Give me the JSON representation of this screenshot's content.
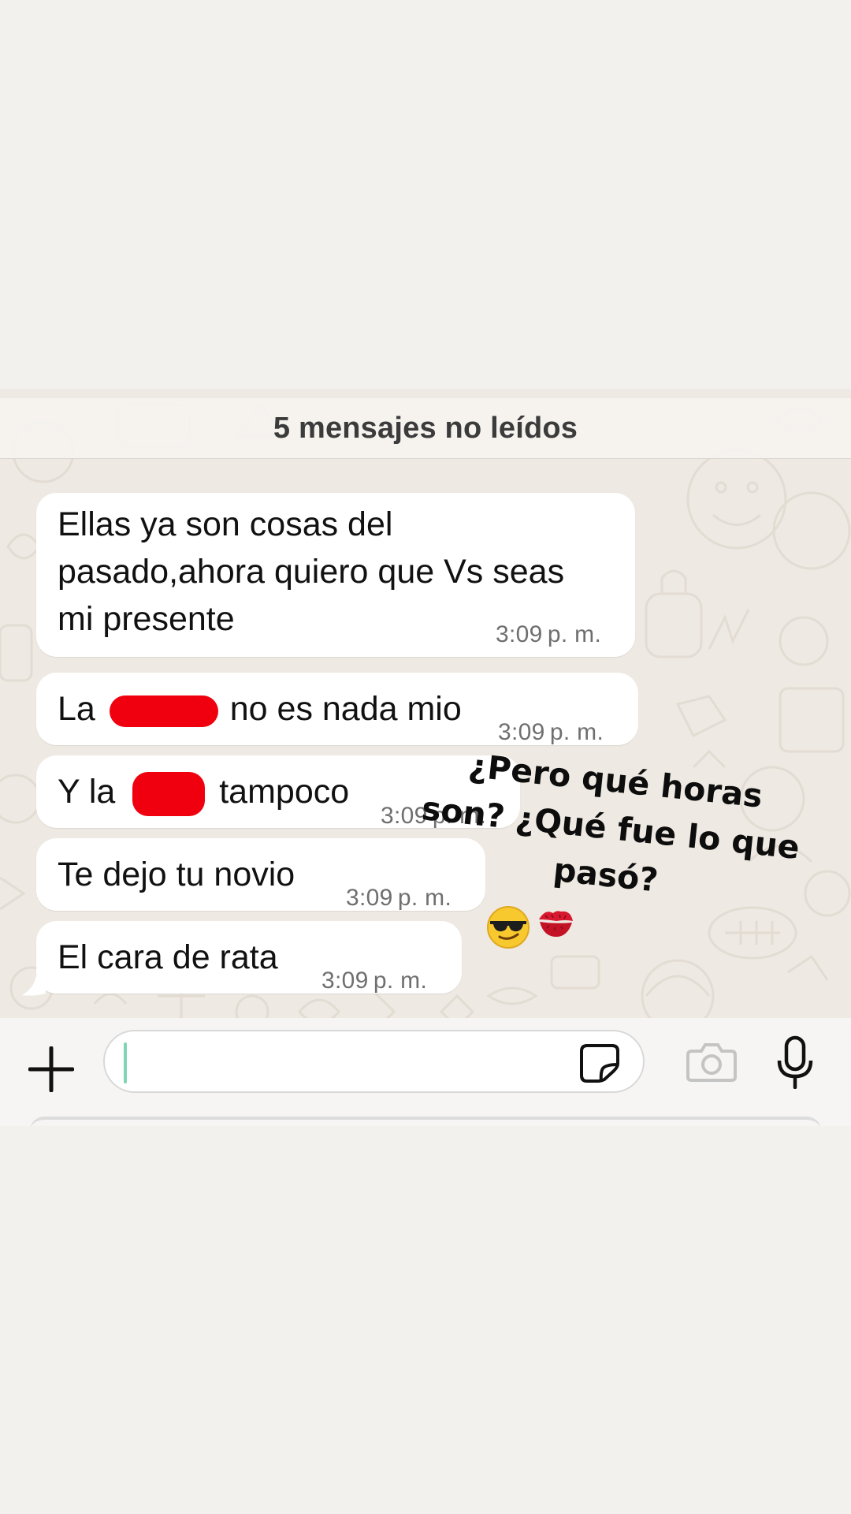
{
  "unread_banner": "5 mensajes no leídos",
  "messages": [
    {
      "lines": [
        "Ellas ya son cosas del",
        "pasado,ahora quiero que Vs seas",
        "mi presente"
      ],
      "time": "3:09 p. m."
    },
    {
      "before": "La",
      "after": "no es nada mio",
      "time": "3:09 p. m."
    },
    {
      "before": "Y la",
      "after": "tampoco",
      "time": "3:09 p. m."
    },
    {
      "text": "Te dejo tu novio",
      "time": "3:09 p. m."
    },
    {
      "text": "El cara de rata",
      "time": "3:09 p. m."
    }
  ],
  "overlay": {
    "lines": [
      "¿Pero qué horas",
      "son? ¿Qué fue lo que",
      "pasó?"
    ],
    "emojis": [
      "smiling-face-with-sunglasses",
      "kiss-mark"
    ]
  },
  "composer": {
    "icons": [
      "plus-icon",
      "sticker-icon",
      "camera-icon",
      "microphone-icon"
    ]
  },
  "colors": {
    "page_background": "#f3f1ee",
    "chat_wallpaper": "#eee9e2",
    "bubble": "#ffffff",
    "redaction": "#f0000e",
    "caret": "#7fd6b3"
  }
}
